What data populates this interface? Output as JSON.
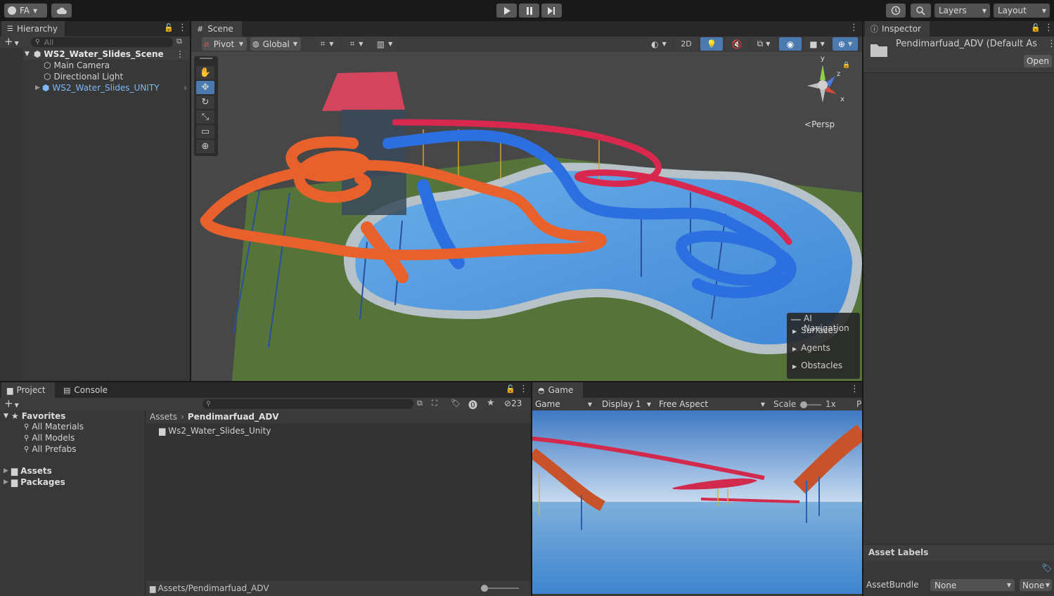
{
  "topbar": {
    "account": "FA",
    "layers": "Layers",
    "layout": "Layout"
  },
  "hierarchy": {
    "tab": "Hierarchy",
    "search_placeholder": "All",
    "scene": "WS2_Water_Slides_Scene",
    "items": [
      "Main Camera",
      "Directional Light",
      "WS2_Water_Slides_UNITY"
    ]
  },
  "scene": {
    "tab": "Scene",
    "pivot": "Pivot",
    "global": "Global",
    "mode_2d": "2D",
    "persp": "Persp",
    "gizmo_axes": [
      "y",
      "z",
      "x"
    ],
    "ai_nav": {
      "title": "AI Navigation",
      "items": [
        "Surfaces",
        "Agents",
        "Obstacles"
      ]
    }
  },
  "inspector": {
    "tab": "Inspector",
    "asset_name": "Pendimarfuad_ADV (Default As",
    "open": "Open",
    "asset_labels": "Asset Labels",
    "asset_bundle_label": "AssetBundle",
    "asset_bundle_value": "None",
    "asset_bundle_variant": "None"
  },
  "project": {
    "tabs": [
      "Project",
      "Console"
    ],
    "hidden_count": "23",
    "favorites": "Favorites",
    "fav_items": [
      "All Materials",
      "All Models",
      "All Prefabs"
    ],
    "roots": [
      "Assets",
      "Packages"
    ],
    "breadcrumb": [
      "Assets",
      "Pendimarfuad_ADV"
    ],
    "folder": "Ws2_Water_Slides_Unity",
    "footer_path": "Assets/Pendimarfuad_ADV"
  },
  "game": {
    "tab": "Game",
    "mode": "Game",
    "display": "Display 1",
    "aspect": "Free Aspect",
    "scale_label": "Scale",
    "scale_value": "1x",
    "cut_label": "P"
  },
  "colors": {
    "accent": "#2c5d87",
    "prefab_blue": "#7cb8f5",
    "grass": "#56733a",
    "water": "#5a9fe0",
    "slide_orange": "#e8612c",
    "slide_blue": "#2b6fe0",
    "slide_red": "#d8284e"
  }
}
